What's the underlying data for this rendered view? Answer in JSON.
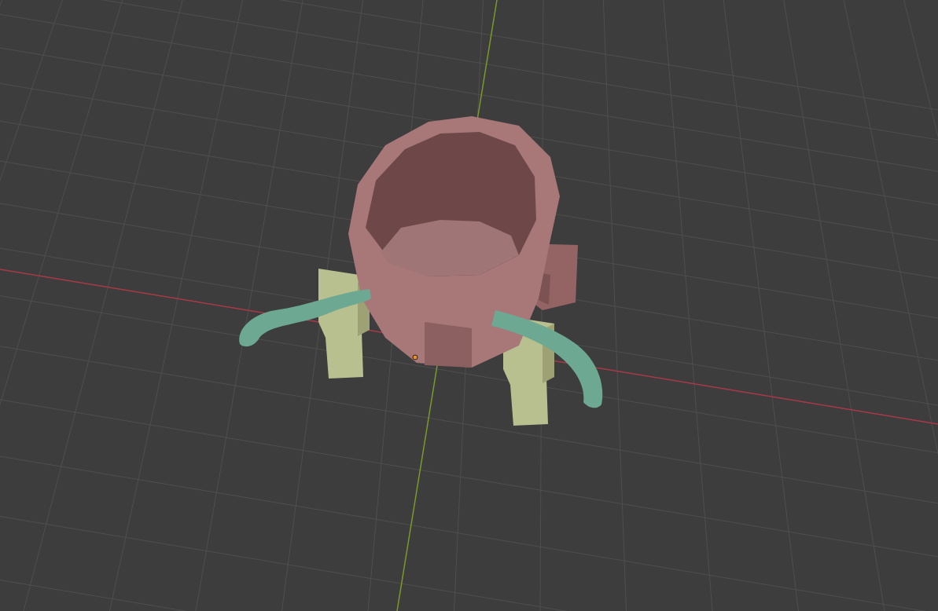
{
  "viewport": {
    "objects": [
      {
        "kind": "stand",
        "color": "#b9c08f"
      },
      {
        "kind": "stand",
        "color": "#b9c08f"
      },
      {
        "kind": "mug",
        "color": "#a87878"
      },
      {
        "kind": "tentacle",
        "color": "#6da893"
      },
      {
        "kind": "tentacle",
        "color": "#6da893"
      }
    ]
  }
}
